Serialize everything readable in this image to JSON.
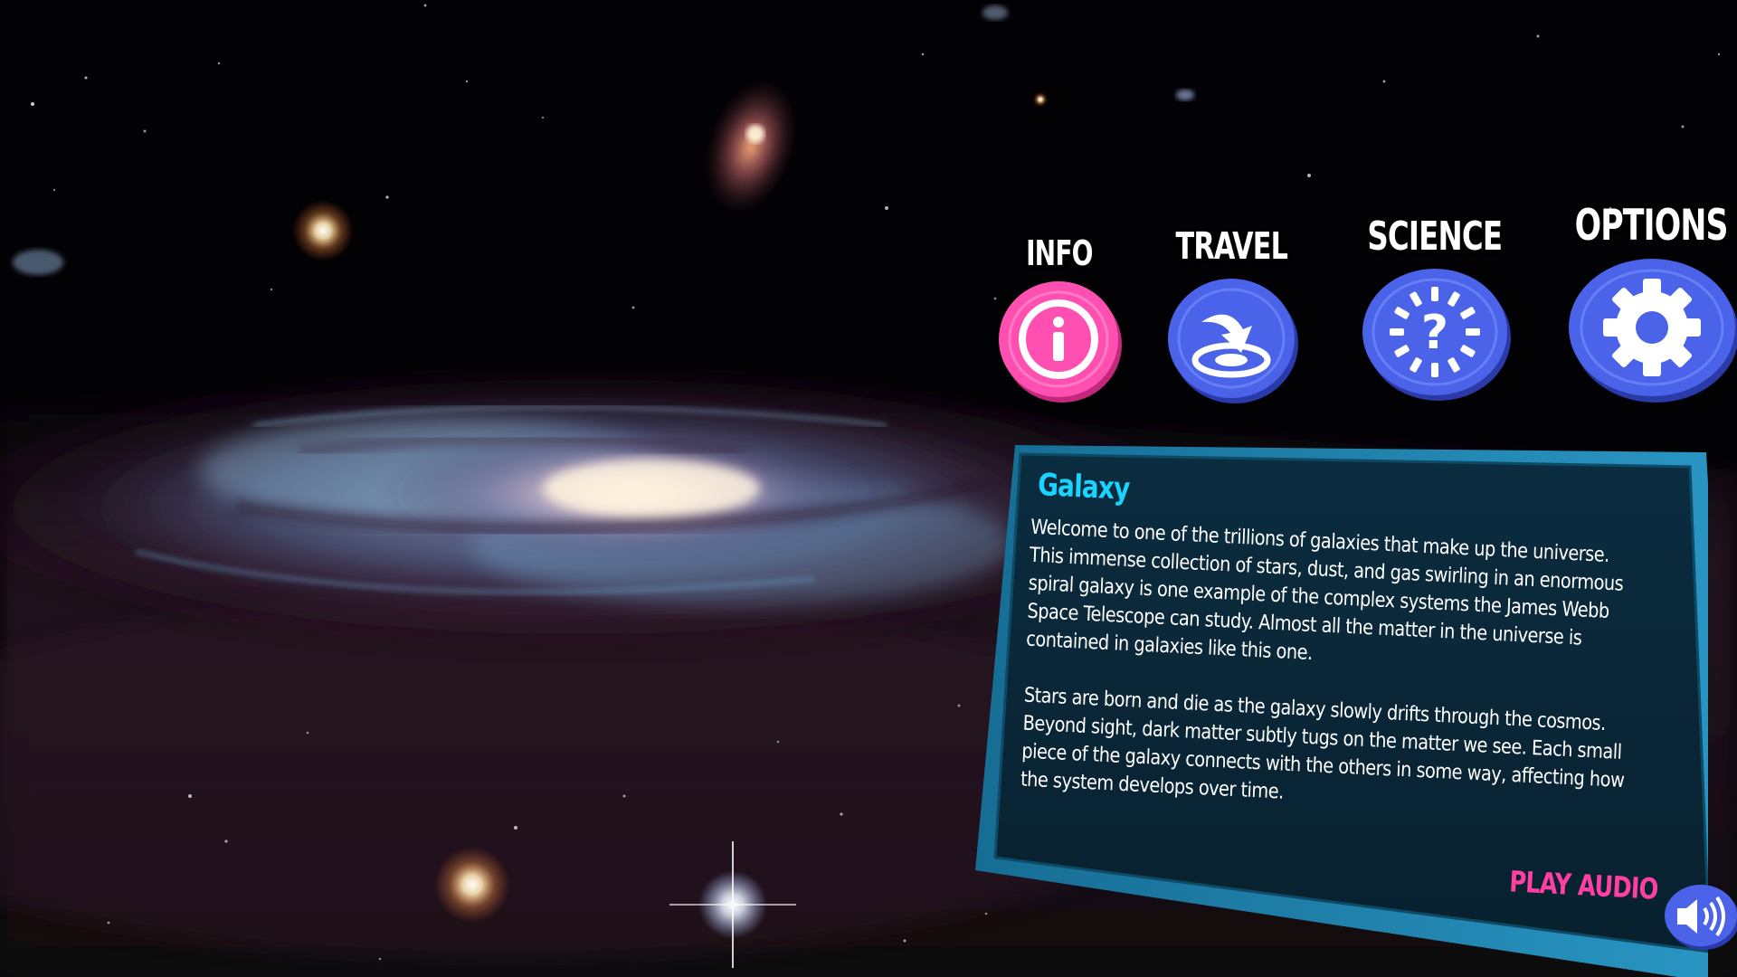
{
  "menu": {
    "info_label": "INFO",
    "travel_label": "TRAVEL",
    "science_label": "SCIENCE",
    "options_label": "OPTIONS"
  },
  "icons": {
    "info": "info-icon",
    "travel": "travel-portal-icon",
    "science": "question-burst-icon",
    "options": "gear-icon",
    "audio": "speaker-icon"
  },
  "colors": {
    "info_button": "#ff4fb0",
    "nav_button": "#4a63e8",
    "panel_background": "#0a2a3c",
    "panel_border": "#1c7ea8",
    "title": "#19d4ff",
    "audio_label": "#ff3fa2"
  },
  "panel": {
    "title": "Galaxy",
    "paragraph_1": "Welcome to one of the trillions of galaxies that make up the universe. This immense collection of stars, dust, and gas swirling in an enormous spiral galaxy is one example of the complex systems the James Webb Space Telescope can study. Almost all the matter in the universe is contained in galaxies like this one.",
    "paragraph_2": "Stars are born and die as the galaxy slowly drifts through the cosmos. Beyond sight, dark matter subtly tugs on the matter we see. Each small piece of the galaxy connects with the others in some way, affecting how the system develops over time.",
    "audio_label": "PLAY AUDIO"
  }
}
